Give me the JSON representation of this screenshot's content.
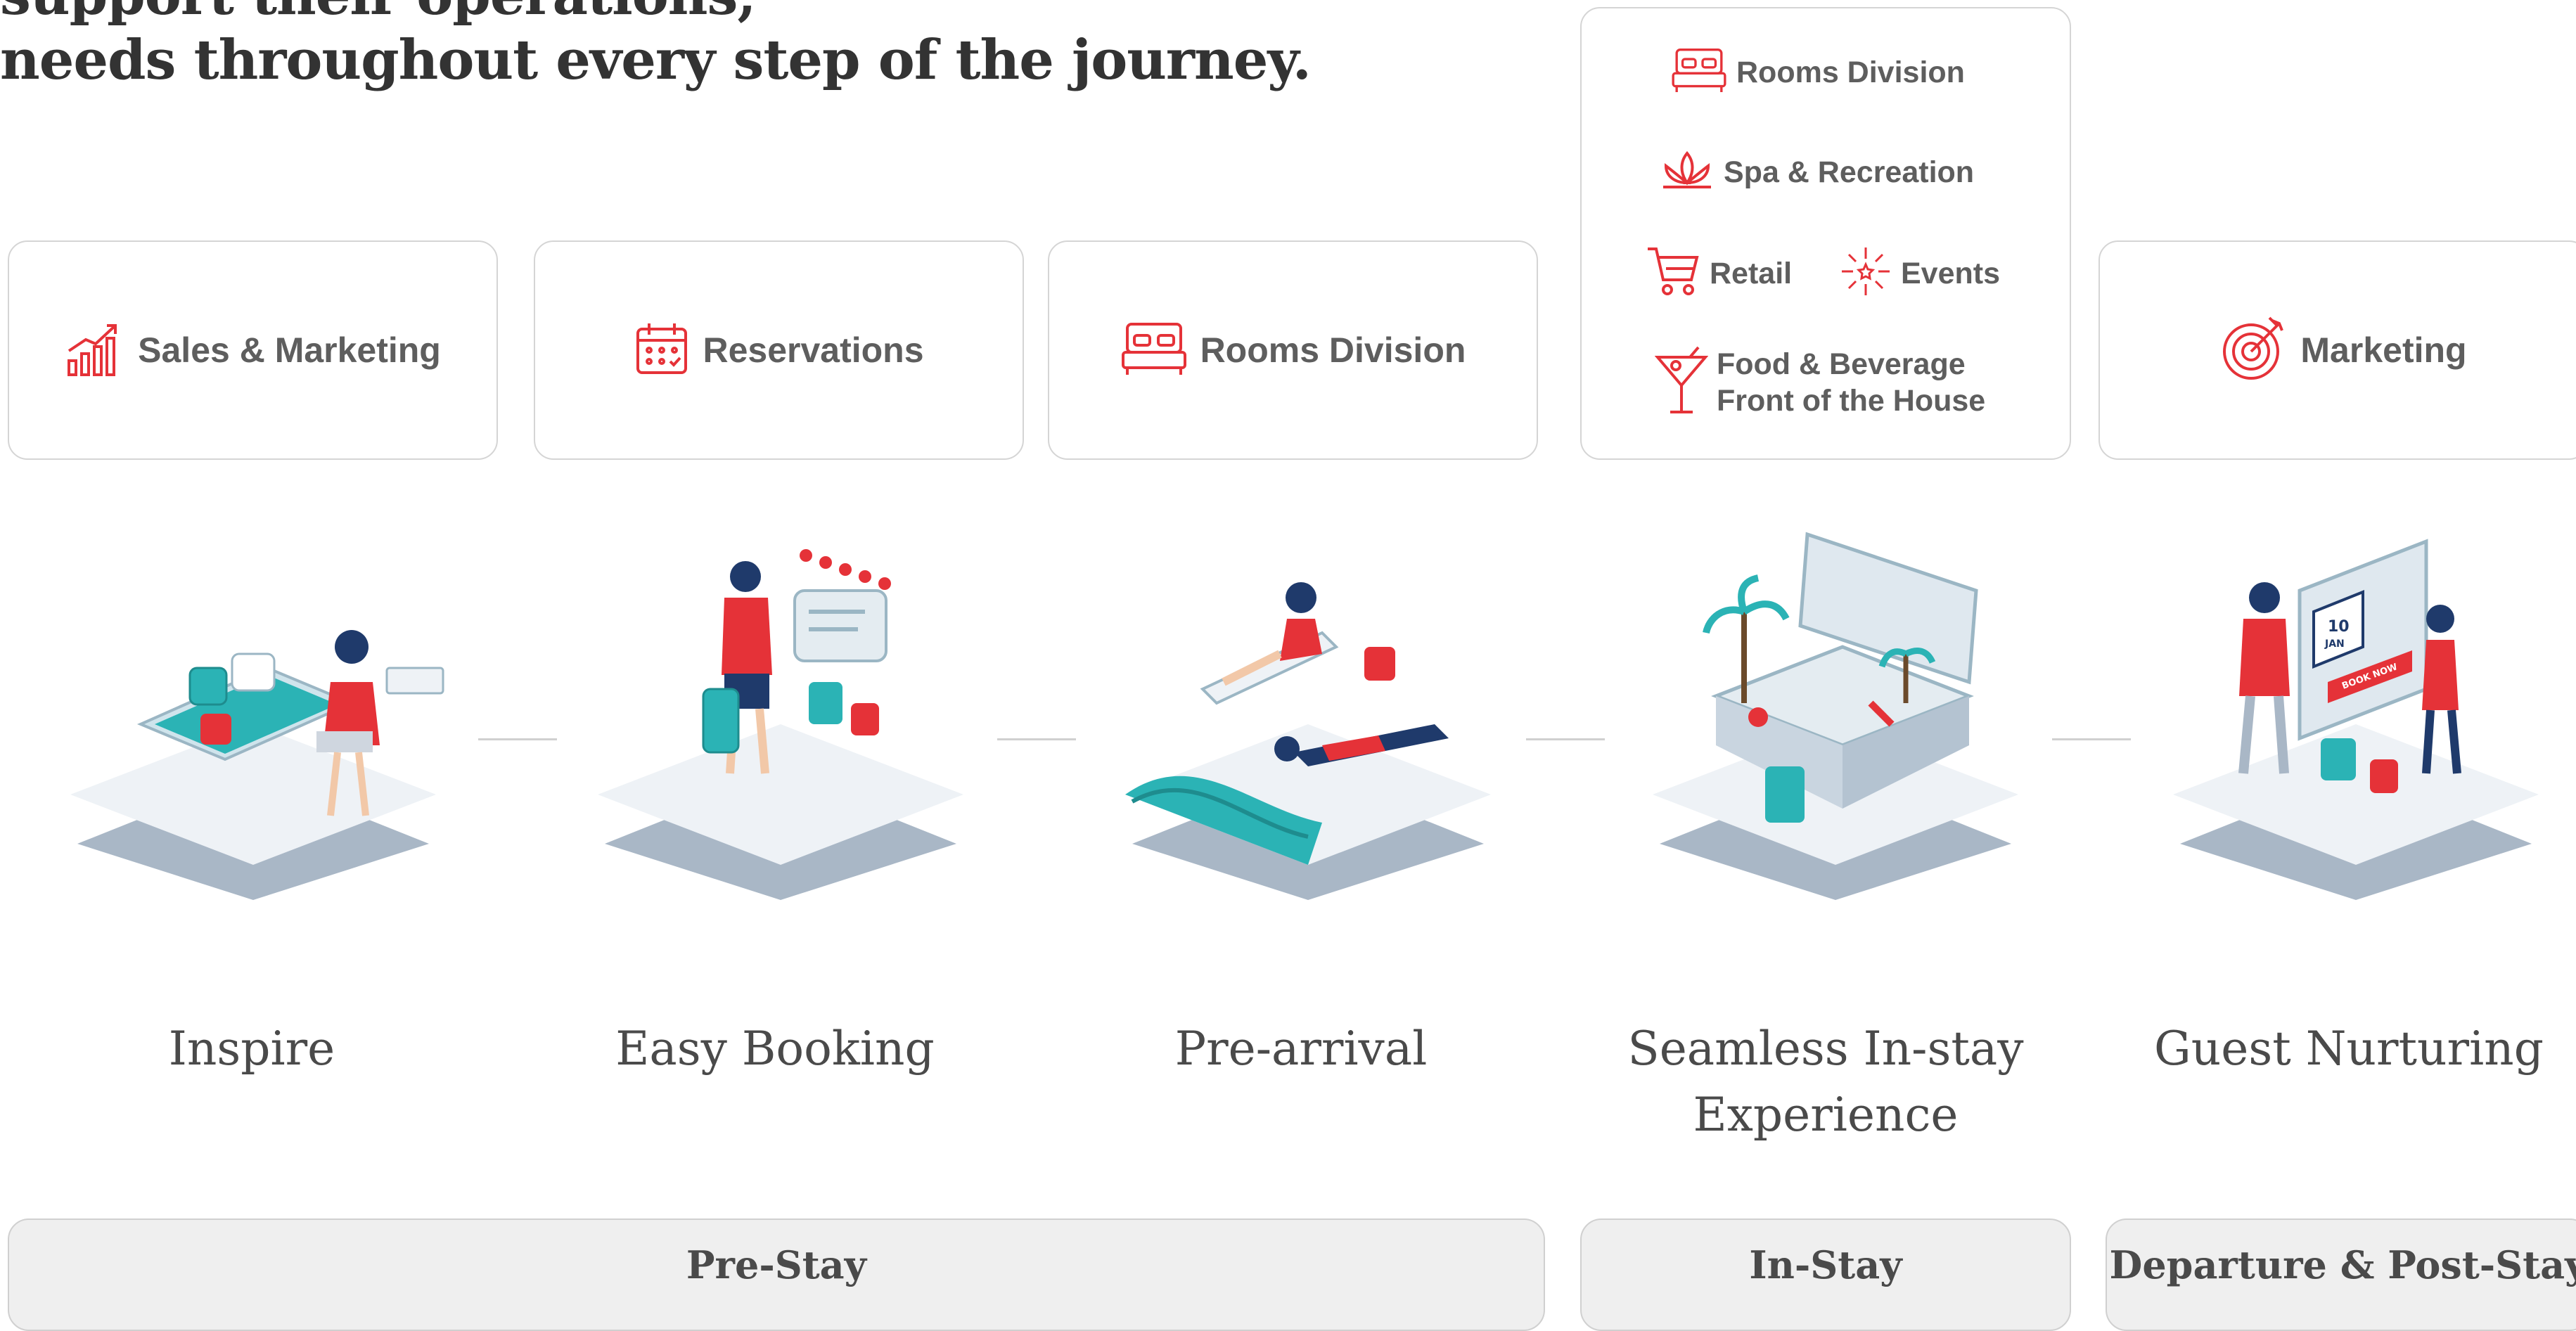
{
  "heading": {
    "line1": "needs throughout every step of the journey.",
    "line0_partial": "support their operations,"
  },
  "departments": {
    "sales_marketing": "Sales & Marketing",
    "reservations": "Reservations",
    "rooms_division": "Rooms Division",
    "marketing": "Marketing",
    "instay": {
      "rooms_division": "Rooms Division",
      "spa": "Spa & Recreation",
      "retail": "Retail",
      "events": "Events",
      "fb_line1": "Food & Beverage",
      "fb_line2": "Front of the House"
    }
  },
  "stages": {
    "inspire": "Inspire",
    "booking": "Easy Booking",
    "prearrival": "Pre-arrival",
    "instay_line1": "Seamless In-stay",
    "instay_line2": "Experience",
    "nurturing": "Guest Nurturing"
  },
  "phases": {
    "pre": "Pre-Stay",
    "in": "In-Stay",
    "post": "Departure & Post-Stay"
  },
  "illustration_labels": {
    "calendar_day": "10",
    "calendar_month": "JAN",
    "booking_button": "BOOK NOW"
  },
  "colors": {
    "accent": "#e53238",
    "teal": "#2bb3b5",
    "navy": "#1f3a6b",
    "text": "#5e5e5e",
    "platform": "#a9b7c6"
  }
}
